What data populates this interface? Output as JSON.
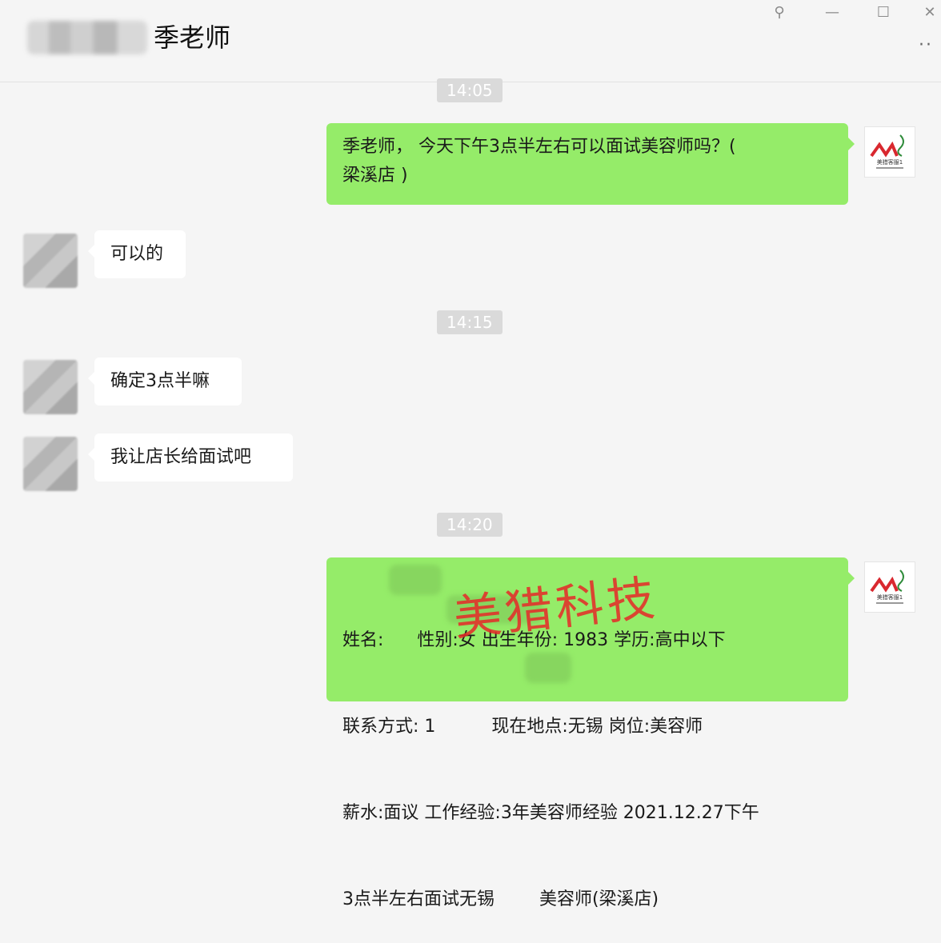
{
  "header": {
    "title": "季老师"
  },
  "window_controls": {
    "pin": "⚲",
    "minimize": "—",
    "maximize": "☐",
    "close": "✕",
    "more": "··"
  },
  "timestamps": [
    "14:05",
    "14:15",
    "14:20"
  ],
  "messages": [
    {
      "from": "self",
      "text_line1": "季老师， 今天下午3点半左右可以面试美容师吗？(",
      "text_line2": "梁溪店 )"
    },
    {
      "from": "other",
      "text": "可以的"
    },
    {
      "from": "other",
      "text": "确定3点半嘛"
    },
    {
      "from": "other",
      "text": "我让店长给面试吧"
    },
    {
      "from": "self",
      "lines": [
        "姓名:      性别:女 出生年份: 1983 学历:高中以下",
        "联系方式: 1          现在地点:无锡 岗位:美容师",
        "薪水:面议 工作经验:3年美容师经验 2021.12.27下午",
        "3点半左右面试无锡        美容师(梁溪店)"
      ]
    }
  ],
  "self_avatar": {
    "logo_text": "ML",
    "caption": "美猎客服1"
  },
  "watermark": "美猎科技",
  "colors": {
    "out_bubble": "#95ec69",
    "in_bubble": "#ffffff",
    "background": "#f5f5f5",
    "logo_red": "#d9282f",
    "logo_green": "#2e8b3a"
  }
}
